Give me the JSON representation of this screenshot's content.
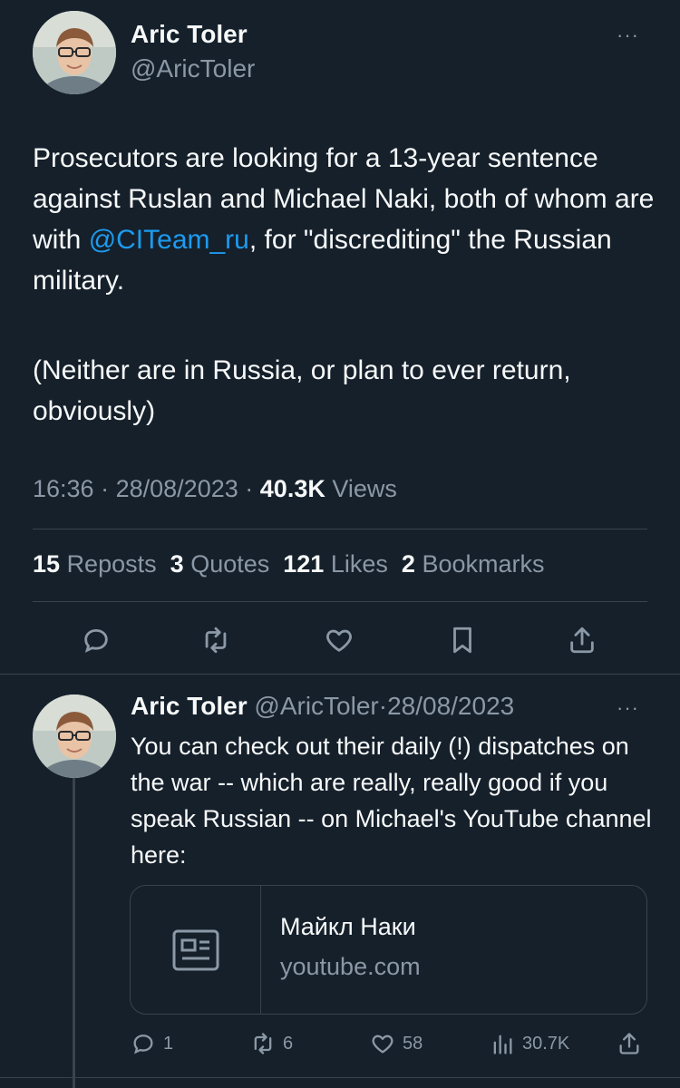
{
  "main_tweet": {
    "author_name": "Aric Toler",
    "author_handle": "@AricToler",
    "more_label": "···",
    "text_part1": "Prosecutors are looking for a 13-year sentence against Ruslan and Michael Naki, both of whom are with ",
    "mention": "@CITeam_ru",
    "text_part2": ", for \"discrediting\" the Russian military.",
    "text_para2": "(Neither are in Russia, or plan to ever return, obviously)",
    "time": "16:36",
    "date": "28/08/2023",
    "views_count": "40.3K",
    "views_label": "Views",
    "separator": "·",
    "stats": {
      "reposts_count": "15",
      "reposts_label": "Reposts",
      "quotes_count": "3",
      "quotes_label": "Quotes",
      "likes_count": "121",
      "likes_label": "Likes",
      "bookmarks_count": "2",
      "bookmarks_label": "Bookmarks"
    },
    "actions": [
      "reply-icon",
      "repost-icon",
      "like-icon",
      "bookmark-icon",
      "share-icon"
    ]
  },
  "reply_tweet": {
    "author_name": "Aric Toler",
    "author_handle": "@AricToler",
    "separator": "·",
    "date": "28/08/2023",
    "more_label": "···",
    "text": "You can check out their daily (!) dispatches on the war -- which are really, really good if you speak Russian -- on Michael's YouTube channel here:",
    "card": {
      "title": "Майкл Наки",
      "domain": "youtube.com",
      "icon": "article-icon"
    },
    "actions": {
      "replies": "1",
      "reposts": "6",
      "likes": "58",
      "views": "30.7K"
    }
  },
  "colors": {
    "background": "#15202b",
    "text": "#f7f9f9",
    "muted": "#8b98a5",
    "accent": "#1d9bf0",
    "divider": "#38444d"
  }
}
